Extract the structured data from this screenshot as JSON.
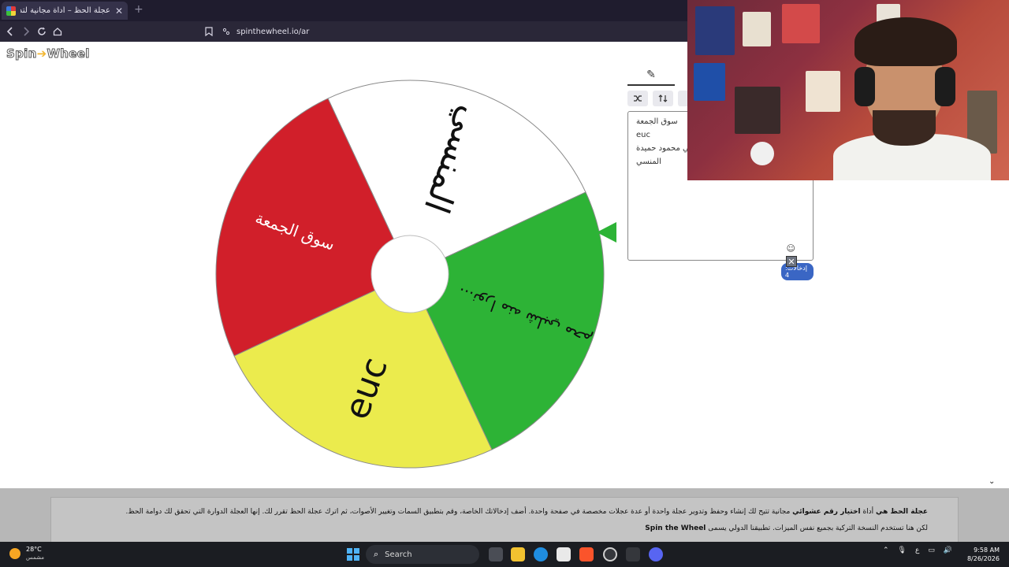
{
  "browser": {
    "tab_title": "عجلة الحظ – أداة مجانية لتدوير الع",
    "url": "spinthewheel.io/ar",
    "new_tab": "+",
    "close": "✕"
  },
  "page": {
    "logo_part1": "Spin",
    "logo_part2": "Wheel",
    "wheel_segments": [
      {
        "label": "المنسي",
        "color": "#ffffff"
      },
      {
        "label": "نورا منه شلبي محم...",
        "color": "#2db336"
      },
      {
        "label": "euc",
        "color": "#ebeb4d"
      },
      {
        "label": "سوق الجمعة",
        "color": "#d11f2a"
      }
    ],
    "entries": [
      "سوق الجمعة",
      "euc",
      "نورا منه شلبي محمود حميدة",
      "المنسي"
    ],
    "entries_count": "إدخالات: 4",
    "edit_icon": "✎",
    "dismiss": "✕",
    "emoji": "☺"
  },
  "info": {
    "line1_bold1": "عجلة الحظ هي",
    "line1_text1": " أداة ",
    "line1_bold2": "اختيار رقم عشوائي",
    "line1_text2": " مجانية تتيح لك إنشاء وحفظ وتدوير عجلة واحدة أو عدة عجلات مخصصة في صفحة واحدة. أضف إدخالاتك الخاصة، وقم بتطبيق السمات وتغيير الأصوات، ثم اترك عجلة الحظ تقرر لك. إنها العجلة الدوارة التي تحقق لك دوامة الحظ.",
    "line2_text1": "لكن هنا تستخدم النسخة التركية بجميع نفس الميزات. تطبيقنا الدولي يسمى ",
    "line2_bold": "Spin the Wheel"
  },
  "taskbar": {
    "temperature": "28°C",
    "weather": "مشمس",
    "search_placeholder": "Search",
    "time": "9:58 AM",
    "date": "8/26/2026",
    "lang": "ع"
  }
}
